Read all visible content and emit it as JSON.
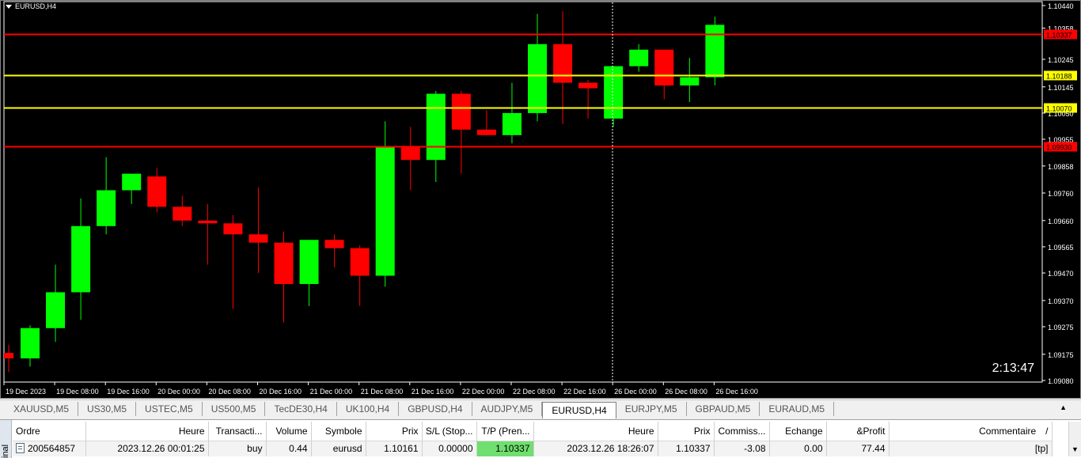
{
  "chart": {
    "title": "EURUSD,H4",
    "timer": "2:13:47",
    "colors": {
      "background": "#000000",
      "bull": "#00ff00",
      "bear": "#ff0000",
      "grid_text": "#ffffff",
      "red_line": "#ff0000",
      "yellow_line": "#ffff00"
    }
  },
  "chart_data": {
    "type": "candlestick",
    "symbol": "EURUSD",
    "timeframe": "H4",
    "ylim": [
      1.0908,
      1.1044
    ],
    "y_ticks": [
      "1.10440",
      "1.10358",
      "1.10245",
      "1.10145",
      "1.10050",
      "1.09955",
      "1.09858",
      "1.09760",
      "1.09660",
      "1.09565",
      "1.09470",
      "1.09370",
      "1.09275",
      "1.09175",
      "1.09080"
    ],
    "x_labels": [
      "19 Dec 2023",
      "19 Dec 08:00",
      "19 Dec 16:00",
      "20 Dec 00:00",
      "20 Dec 08:00",
      "20 Dec 16:00",
      "21 Dec 00:00",
      "21 Dec 08:00",
      "21 Dec 16:00",
      "22 Dec 00:00",
      "22 Dec 08:00",
      "22 Dec 16:00",
      "26 Dec 00:00",
      "26 Dec 08:00",
      "26 Dec 16:00"
    ],
    "candles": [
      {
        "o": 1.0918,
        "h": 1.0921,
        "l": 1.0911,
        "c": 1.0916
      },
      {
        "o": 1.0916,
        "h": 1.0928,
        "l": 1.0913,
        "c": 1.0927
      },
      {
        "o": 1.0927,
        "h": 1.095,
        "l": 1.0922,
        "c": 1.094
      },
      {
        "o": 1.094,
        "h": 1.0974,
        "l": 1.093,
        "c": 1.0964
      },
      {
        "o": 1.0964,
        "h": 1.0989,
        "l": 1.0961,
        "c": 1.0977
      },
      {
        "o": 1.0977,
        "h": 1.0982,
        "l": 1.0972,
        "c": 1.0983
      },
      {
        "o": 1.0982,
        "h": 1.0985,
        "l": 1.0969,
        "c": 1.0971
      },
      {
        "o": 1.0971,
        "h": 1.0975,
        "l": 1.0964,
        "c": 1.0966
      },
      {
        "o": 1.0966,
        "h": 1.0972,
        "l": 1.095,
        "c": 1.0965
      },
      {
        "o": 1.0965,
        "h": 1.0968,
        "l": 1.0934,
        "c": 1.0961
      },
      {
        "o": 1.0961,
        "h": 1.0978,
        "l": 1.0947,
        "c": 1.0958
      },
      {
        "o": 1.0958,
        "h": 1.0962,
        "l": 1.0929,
        "c": 1.0943
      },
      {
        "o": 1.0943,
        "h": 1.0956,
        "l": 1.0935,
        "c": 1.0959
      },
      {
        "o": 1.0959,
        "h": 1.0961,
        "l": 1.0949,
        "c": 1.0956
      },
      {
        "o": 1.0956,
        "h": 1.0957,
        "l": 1.0935,
        "c": 1.0946
      },
      {
        "o": 1.0946,
        "h": 1.1002,
        "l": 1.0942,
        "c": 1.0993
      },
      {
        "o": 1.0993,
        "h": 1.1,
        "l": 1.0977,
        "c": 1.0988
      },
      {
        "o": 1.0988,
        "h": 1.1013,
        "l": 1.098,
        "c": 1.1012
      },
      {
        "o": 1.1012,
        "h": 1.1013,
        "l": 1.0983,
        "c": 1.0999
      },
      {
        "o": 1.0999,
        "h": 1.1006,
        "l": 1.0997,
        "c": 1.0997
      },
      {
        "o": 1.0997,
        "h": 1.1016,
        "l": 1.0994,
        "c": 1.1005
      },
      {
        "o": 1.1005,
        "h": 1.1041,
        "l": 1.1002,
        "c": 1.103
      },
      {
        "o": 1.103,
        "h": 1.1042,
        "l": 1.1001,
        "c": 1.1016
      },
      {
        "o": 1.1016,
        "h": 1.1017,
        "l": 1.1003,
        "c": 1.1014
      },
      {
        "o": 1.1003,
        "h": 1.1022,
        "l": 1.1,
        "c": 1.1022
      },
      {
        "o": 1.1022,
        "h": 1.103,
        "l": 1.102,
        "c": 1.1028
      },
      {
        "o": 1.1028,
        "h": 1.1028,
        "l": 1.101,
        "c": 1.1015
      },
      {
        "o": 1.1015,
        "h": 1.1025,
        "l": 1.1009,
        "c": 1.1018
      },
      {
        "o": 1.1018,
        "h": 1.104,
        "l": 1.1015,
        "c": 1.1037
      }
    ],
    "hlines": [
      {
        "price": 1.10337,
        "label": "1.10337",
        "color": "#ff0000",
        "label_bg": "#ff0000",
        "label_fg": "#000000"
      },
      {
        "price": 1.10188,
        "label": "1.10188",
        "color": "#ffff00",
        "label_bg": "#ffff00",
        "label_fg": "#000000"
      },
      {
        "price": 1.1007,
        "label": "1.10070",
        "color": "#ffff00",
        "label_bg": "#ffff00",
        "label_fg": "#000000"
      },
      {
        "price": 1.0993,
        "label": "1.09930",
        "color": "#ff0000",
        "label_bg": "#ff0000",
        "label_fg": "#000000"
      }
    ],
    "crosshair_label": "26 Dec 00:00",
    "grid": false
  },
  "tabs": [
    {
      "label": "XAUUSD,M5",
      "active": false
    },
    {
      "label": "US30,M5",
      "active": false
    },
    {
      "label": "USTEC,M5",
      "active": false
    },
    {
      "label": "US500,M5",
      "active": false
    },
    {
      "label": "TecDE30,H4",
      "active": false
    },
    {
      "label": "UK100,H4",
      "active": false
    },
    {
      "label": "GBPUSD,H4",
      "active": false
    },
    {
      "label": "AUDJPY,M5",
      "active": false
    },
    {
      "label": "EURUSD,H4",
      "active": true
    },
    {
      "label": "EURJPY,M5",
      "active": false
    },
    {
      "label": "GBPAUD,M5",
      "active": false
    },
    {
      "label": "EURAUD,M5",
      "active": false
    }
  ],
  "terminal": {
    "side_label": "inal",
    "columns": [
      "Ordre",
      "Heure",
      "Transacti...",
      "Volume",
      "Symbole",
      "Prix",
      "S/L (Stop...",
      "T/P (Pren...",
      "Heure",
      "Prix",
      "Commiss...",
      "Echange",
      "&Profit",
      "Commentaire"
    ],
    "rows": [
      [
        "200564857",
        "2023.12.26 00:01:25",
        "buy",
        "0.44",
        "eurusd",
        "1.10161",
        "0.00000",
        "1.10337",
        "2023.12.26 18:26:07",
        "1.10337",
        "-3.08",
        "0.00",
        "77.44",
        "[tp]"
      ]
    ],
    "sort_indicator": "/",
    "tp_highlight": "#6fdf6f"
  }
}
